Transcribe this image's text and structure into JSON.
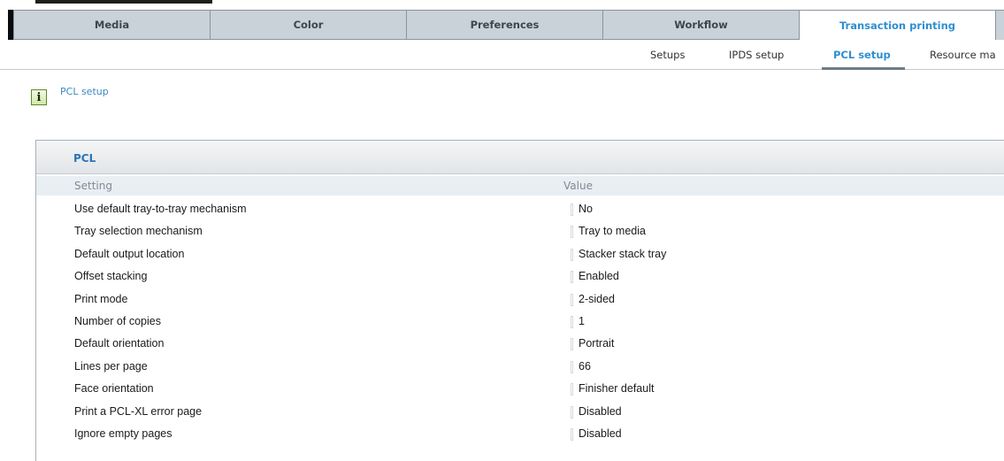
{
  "main_tabs": [
    {
      "label": "Media"
    },
    {
      "label": "Color"
    },
    {
      "label": "Preferences"
    },
    {
      "label": "Workflow"
    },
    {
      "label": "Transaction printing",
      "active": true
    }
  ],
  "sub_tabs": [
    {
      "label": "Setups"
    },
    {
      "label": "IPDS setup"
    },
    {
      "label": "PCL setup",
      "active": true
    },
    {
      "label": "Resource ma"
    }
  ],
  "info": {
    "icon": "info-icon",
    "text": "PCL setup"
  },
  "panel": {
    "title": "PCL",
    "columns": {
      "setting": "Setting",
      "value": "Value"
    },
    "rows": [
      {
        "setting": "Use default tray-to-tray mechanism",
        "value": "No"
      },
      {
        "setting": "Tray selection mechanism",
        "value": "Tray to media"
      },
      {
        "setting": "Default output location",
        "value": "Stacker stack tray"
      },
      {
        "setting": "Offset stacking",
        "value": "Enabled"
      },
      {
        "setting": "Print mode",
        "value": "2-sided"
      },
      {
        "setting": "Number of copies",
        "value": "1"
      },
      {
        "setting": "Default orientation",
        "value": "Portrait"
      },
      {
        "setting": "Lines per page",
        "value": "66"
      },
      {
        "setting": "Face orientation",
        "value": "Finisher default"
      },
      {
        "setting": "Print a PCL-XL error page",
        "value": "Disabled"
      },
      {
        "setting": "Ignore empty pages",
        "value": "Disabled"
      }
    ]
  },
  "colors": {
    "accent": "#2f8fd0",
    "title": "#2f73b5",
    "tab_bg": "#c9d1d9"
  }
}
